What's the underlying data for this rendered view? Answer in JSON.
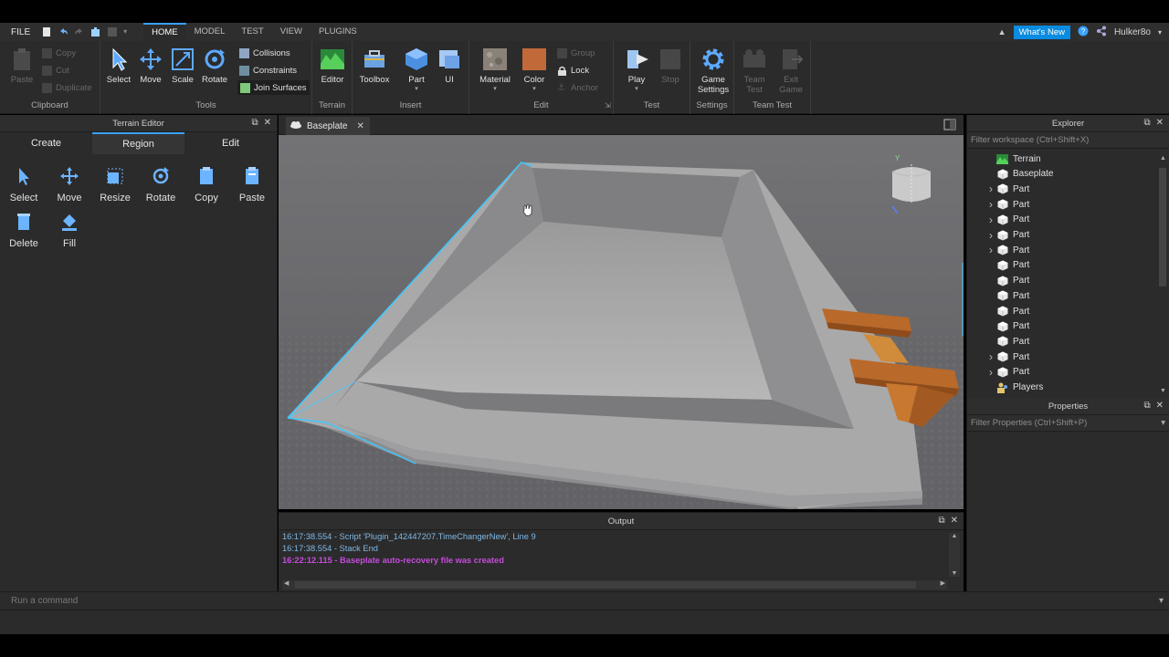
{
  "menubar": {
    "file": "FILE",
    "tabs": [
      "HOME",
      "MODEL",
      "TEST",
      "VIEW",
      "PLUGINS"
    ],
    "whats_new": "What's New",
    "username": "Hulker8o"
  },
  "ribbon": {
    "clipboard": {
      "paste": "Paste",
      "copy": "Copy",
      "cut": "Cut",
      "duplicate": "Duplicate",
      "label": "Clipboard"
    },
    "tools": {
      "select": "Select",
      "move": "Move",
      "scale": "Scale",
      "rotate": "Rotate",
      "collisions": "Collisions",
      "constraints": "Constraints",
      "join_surfaces": "Join Surfaces",
      "label": "Tools"
    },
    "terrain": {
      "editor": "Editor",
      "label": "Terrain"
    },
    "insert": {
      "toolbox": "Toolbox",
      "part": "Part",
      "ui": "UI",
      "label": "Insert"
    },
    "edit": {
      "material": "Material",
      "color": "Color",
      "group": "Group",
      "lock": "Lock",
      "anchor": "Anchor",
      "label": "Edit"
    },
    "test": {
      "play": "Play",
      "stop": "Stop",
      "label": "Test"
    },
    "settings": {
      "game_settings_line1": "Game",
      "game_settings_line2": "Settings",
      "label": "Settings"
    },
    "team_test": {
      "team_test_line1": "Team",
      "team_test_line2": "Test",
      "exit_game_line1": "Exit",
      "exit_game_line2": "Game",
      "label": "Team Test"
    }
  },
  "terrain_editor": {
    "title": "Terrain Editor",
    "tabs": [
      "Create",
      "Region",
      "Edit"
    ],
    "active_tab": "Region",
    "tools": [
      "Select",
      "Move",
      "Resize",
      "Rotate",
      "Copy",
      "Paste",
      "Delete",
      "Fill"
    ]
  },
  "viewport": {
    "doc_tab": "Baseplate",
    "gizmo_axis": "Y"
  },
  "explorer": {
    "title": "Explorer",
    "filter_placeholder": "Filter workspace (Ctrl+Shift+X)",
    "items": [
      {
        "label": "Terrain",
        "expandable": false,
        "icon": "terrain-icon"
      },
      {
        "label": "Baseplate",
        "expandable": false,
        "icon": "part-icon"
      },
      {
        "label": "Part",
        "expandable": true,
        "icon": "part-icon"
      },
      {
        "label": "Part",
        "expandable": true,
        "icon": "part-icon"
      },
      {
        "label": "Part",
        "expandable": true,
        "icon": "part-icon"
      },
      {
        "label": "Part",
        "expandable": true,
        "icon": "part-icon"
      },
      {
        "label": "Part",
        "expandable": true,
        "icon": "part-icon"
      },
      {
        "label": "Part",
        "expandable": false,
        "icon": "part-icon"
      },
      {
        "label": "Part",
        "expandable": false,
        "icon": "part-icon"
      },
      {
        "label": "Part",
        "expandable": false,
        "icon": "part-icon"
      },
      {
        "label": "Part",
        "expandable": false,
        "icon": "part-icon"
      },
      {
        "label": "Part",
        "expandable": false,
        "icon": "part-icon"
      },
      {
        "label": "Part",
        "expandable": false,
        "icon": "part-icon"
      },
      {
        "label": "Part",
        "expandable": true,
        "icon": "part-icon"
      },
      {
        "label": "Part",
        "expandable": true,
        "icon": "part-icon"
      },
      {
        "label": "Players",
        "expandable": false,
        "icon": "players-icon"
      }
    ]
  },
  "properties": {
    "title": "Properties",
    "filter_placeholder": "Filter Properties (Ctrl+Shift+P)"
  },
  "output": {
    "title": "Output",
    "lines": [
      {
        "text": "16:17:38.554 - Script 'Plugin_142447207.TimeChangerNew', Line 9",
        "color": "#7fb8e6"
      },
      {
        "text": "16:17:38.554 - Stack End",
        "color": "#7fb8e6"
      },
      {
        "text": "16:22:12.115 - Baseplate auto-recovery file was created",
        "color": "#c64cdd"
      }
    ]
  },
  "command_bar": {
    "placeholder": "Run a command"
  },
  "colors": {
    "accent": "#3aa1ff",
    "whats_new_bg": "#0a8ce0",
    "selection_outline": "#3ec8ff"
  }
}
